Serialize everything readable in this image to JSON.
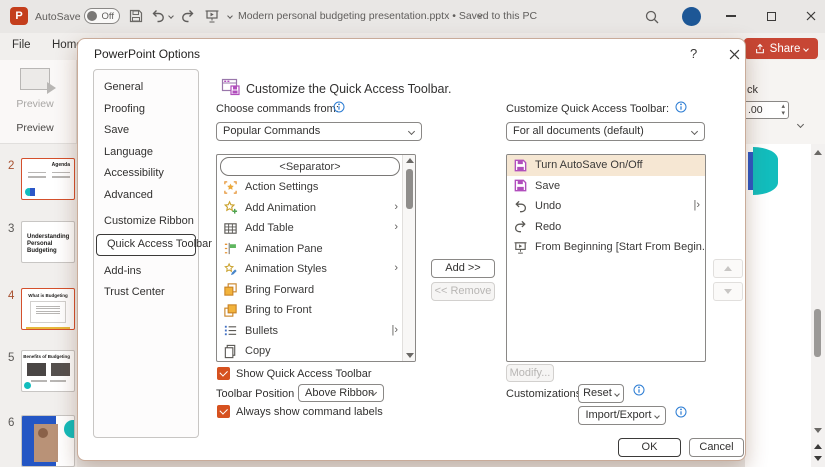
{
  "colors": {
    "accent_orange": "#d6511f",
    "brand_red": "#c74634",
    "teal": "#12bdbd",
    "highlight_tan": "#f6e7d3",
    "save_purple": "#b14ebc",
    "info_blue": "#2b7cd3",
    "avatar_blue": "#1d5796"
  },
  "titlebar": {
    "autosave_label": "AutoSave",
    "autosave_state": "Off",
    "doc_title": "Modern personal budgeting presentation.pptx • Saved to this PC"
  },
  "ribbon": {
    "file_tab": "File",
    "home_tab": "Home",
    "share_label": "Share",
    "preview_button_label": "Preview",
    "preview_group_label": "Preview",
    "clipped_label": "ck",
    "spinner_value": ".00"
  },
  "slide_panel": {
    "thumbnails": [
      {
        "num": "2",
        "kind": "agenda",
        "title": "Agenda",
        "accent": true
      },
      {
        "num": "3",
        "kind": "big-title",
        "title": "Understanding Personal Budgeting",
        "accent": false
      },
      {
        "num": "4",
        "kind": "text",
        "title": "What is Budgeting",
        "accent": true
      },
      {
        "num": "5",
        "kind": "images",
        "title": "Benefits of Budgeting",
        "accent": false
      },
      {
        "num": "6",
        "kind": "photo",
        "title": "",
        "accent": false
      }
    ]
  },
  "dialog": {
    "title": "PowerPoint Options",
    "help_label": "?",
    "nav_selected": "Quick Access Toolbar",
    "nav_items": [
      {
        "label": "General"
      },
      {
        "label": "Proofing"
      },
      {
        "label": "Save"
      },
      {
        "label": "Language"
      },
      {
        "label": "Accessibility"
      },
      {
        "label": "Advanced"
      },
      {
        "label": "Customize Ribbon",
        "gap": true
      },
      {
        "label": "Quick Access Toolbar"
      },
      {
        "label": "Add-ins",
        "gap": true
      },
      {
        "label": "Trust Center"
      }
    ],
    "header_title": "Customize the Quick Access Toolbar.",
    "choose_label": "Choose commands from:",
    "choose_value": "Popular Commands",
    "customize_label": "Customize Quick Access Toolbar:",
    "customize_value": "For all documents (default)",
    "left_commands": [
      {
        "label": "<Separator>",
        "type": "separator",
        "selected": true
      },
      {
        "icon": "action-settings",
        "label": "Action Settings"
      },
      {
        "icon": "add-animation",
        "label": "Add Animation",
        "submenu": "›"
      },
      {
        "icon": "add-table",
        "label": "Add Table",
        "submenu": "›"
      },
      {
        "icon": "animation-pane",
        "label": "Animation Pane"
      },
      {
        "icon": "animation-styles",
        "label": "Animation Styles",
        "submenu": "›"
      },
      {
        "icon": "bring-forward",
        "label": "Bring Forward"
      },
      {
        "icon": "bring-to-front",
        "label": "Bring to Front"
      },
      {
        "icon": "bullets",
        "label": "Bullets",
        "submenu": "|›"
      },
      {
        "icon": "copy",
        "label": "Copy"
      }
    ],
    "right_commands": [
      {
        "icon": "save",
        "label": "Turn AutoSave On/Off",
        "highlighted": true
      },
      {
        "icon": "save",
        "label": "Save"
      },
      {
        "icon": "undo",
        "label": "Undo",
        "submenu": "|›"
      },
      {
        "icon": "redo",
        "label": "Redo"
      },
      {
        "icon": "slideshow",
        "label": "From Beginning [Start From Begin..."
      }
    ],
    "add_label": "Add >>",
    "remove_label": "<< Remove",
    "modify_label": "Modify...",
    "show_qat_label": "Show Quick Access Toolbar",
    "toolbar_position_label": "Toolbar Position",
    "toolbar_position_value": "Above Ribbon",
    "always_show_label": "Always show command labels",
    "customizations_label": "Customizations:",
    "reset_label": "Reset",
    "import_export_label": "Import/Export",
    "ok_label": "OK",
    "cancel_label": "Cancel"
  }
}
